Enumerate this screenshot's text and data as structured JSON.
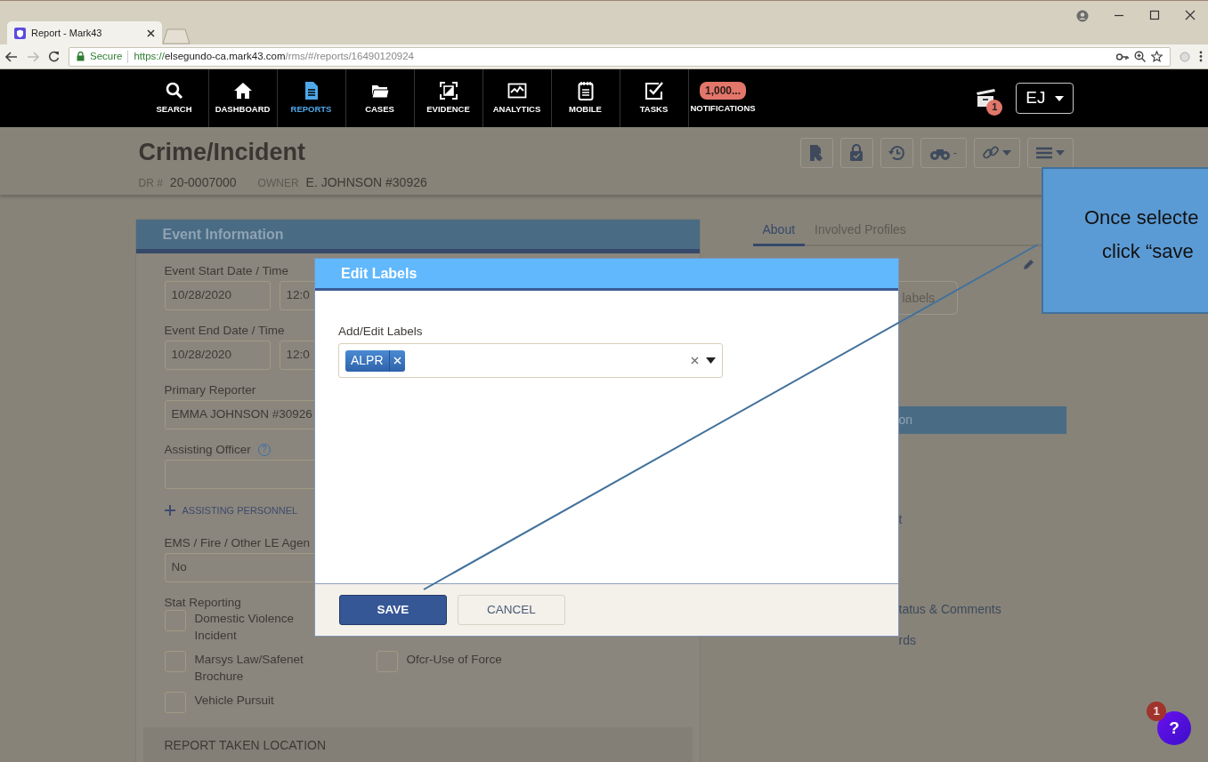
{
  "browser": {
    "tab_title": "Report - Mark43",
    "secure": "Secure",
    "url": {
      "scheme": "https://",
      "host": "elsegundo-ca.mark43.com",
      "path": "/rms/#/reports/16490120924"
    }
  },
  "nav": {
    "items": [
      {
        "label": "SEARCH",
        "selected": false
      },
      {
        "label": "DASHBOARD",
        "selected": false
      },
      {
        "label": "REPORTS",
        "selected": true
      },
      {
        "label": "CASES",
        "selected": false
      },
      {
        "label": "EVIDENCE",
        "selected": false
      },
      {
        "label": "ANALYTICS",
        "selected": false
      },
      {
        "label": "MOBILE",
        "selected": false
      },
      {
        "label": "TASKS",
        "selected": false
      }
    ],
    "notifications": {
      "label": "NOTIFICATIONS",
      "badge": "1,000..."
    },
    "inbox_badge": "1",
    "user": "EJ"
  },
  "report": {
    "title": "Crime/Incident",
    "dr_label": "DR #",
    "dr": "20-0007000",
    "owner_label": "OWNER",
    "owner": "E. JOHNSON #30926"
  },
  "actions": [
    {
      "caret": false
    },
    {
      "caret": false
    },
    {
      "caret": false
    },
    {
      "caret": false,
      "suffix": "-"
    },
    {
      "caret": true
    },
    {
      "caret": true
    }
  ],
  "event_panel": {
    "title": "Event Information",
    "fields": [
      {
        "kind": "datetime",
        "label": "Event Start Date / Time",
        "date": "10/28/2020",
        "time": "12:0"
      },
      {
        "kind": "datetime",
        "label": "Event End Date / Time",
        "date": "10/28/2020",
        "time": "12:0"
      },
      {
        "kind": "text",
        "label": "Primary Reporter",
        "value": "EMMA JOHNSON #30926"
      },
      {
        "kind": "text",
        "label": "Assisting Officer",
        "help": "?"
      },
      {
        "kind": "add",
        "label": "ASSISTING PERSONNEL"
      },
      {
        "kind": "text",
        "label": "EMS / Fire / Other LE Agen",
        "value": "No"
      },
      {
        "kind": "checks",
        "label": "Stat Reporting",
        "rows": [
          [
            {
              "label": "Domestic Violence Incident",
              "checked": false
            }
          ],
          [
            {
              "label": "Marsys Law/Safenet Brochure",
              "checked": false
            },
            {
              "label": "Ofcr-Use of Force",
              "checked": false
            }
          ],
          [
            {
              "label": "Vehicle Pursuit",
              "checked": false
            }
          ]
        ]
      }
    ],
    "next_section": "REPORT TAKEN LOCATION"
  },
  "side": {
    "tabs": [
      {
        "label": "About",
        "selected": true
      },
      {
        "label": "Involved Profiles",
        "selected": false
      }
    ],
    "labels_button": "labels",
    "section_title": "on",
    "items": [
      "t",
      "tatus & Comments",
      "rds"
    ]
  },
  "modal": {
    "title": "Edit Labels",
    "field_label": "Add/Edit Labels",
    "tags": [
      "ALPR"
    ],
    "buttons": [
      {
        "label": "SAVE",
        "kind": "primary"
      },
      {
        "label": "CANCEL",
        "kind": "secondary"
      }
    ]
  },
  "callout": {
    "lines": [
      "Once selecte",
      "click “save"
    ]
  },
  "help": {
    "badge": "1",
    "label": "?"
  }
}
